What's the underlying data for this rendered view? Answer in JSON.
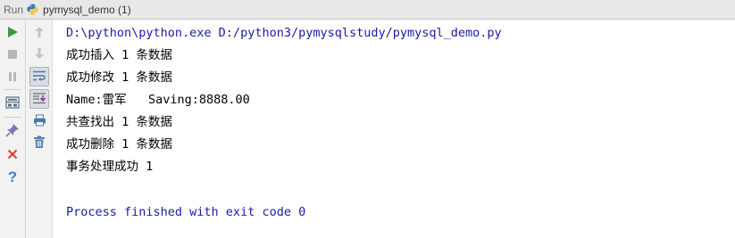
{
  "titlebar": {
    "run_label": "Run",
    "tab_label": "pymysql_demo (1)"
  },
  "toolbar_left": [
    {
      "name": "run-icon",
      "label": "Run"
    },
    {
      "name": "stop-icon",
      "label": "Stop"
    },
    {
      "name": "pause-icon",
      "label": "Pause"
    },
    {
      "name": "layout-icon",
      "label": "Restore Layout"
    },
    {
      "name": "pin-icon",
      "label": "Pin Tab"
    },
    {
      "name": "close-icon",
      "label": "Close"
    },
    {
      "name": "help-icon",
      "label": "Help"
    }
  ],
  "toolbar_right": [
    {
      "name": "up-arrow-icon",
      "label": "Up the stack"
    },
    {
      "name": "down-arrow-icon",
      "label": "Down the stack"
    },
    {
      "name": "soft-wrap-icon",
      "label": "Soft-wrap"
    },
    {
      "name": "scroll-to-end-icon",
      "label": "Scroll to the end"
    },
    {
      "name": "print-icon",
      "label": "Print"
    },
    {
      "name": "trash-icon",
      "label": "Clear All"
    }
  ],
  "colors": {
    "command_text": "#1a1aa6",
    "output_text": "#000000",
    "run_green": "#3c9a3c",
    "close_red": "#d9413a",
    "help_blue": "#3d7fd1"
  },
  "console": {
    "command": "D:\\python\\python.exe D:/python3/pymysqlstudy/pymysql_demo.py",
    "lines": [
      "成功插入 1 条数据",
      "成功修改 1 条数据",
      "Name:雷军   Saving:8888.00",
      "共查找出 1 条数据",
      "成功删除 1 条数据",
      "事务处理成功 1"
    ],
    "exit_message": "Process finished with exit code 0"
  }
}
